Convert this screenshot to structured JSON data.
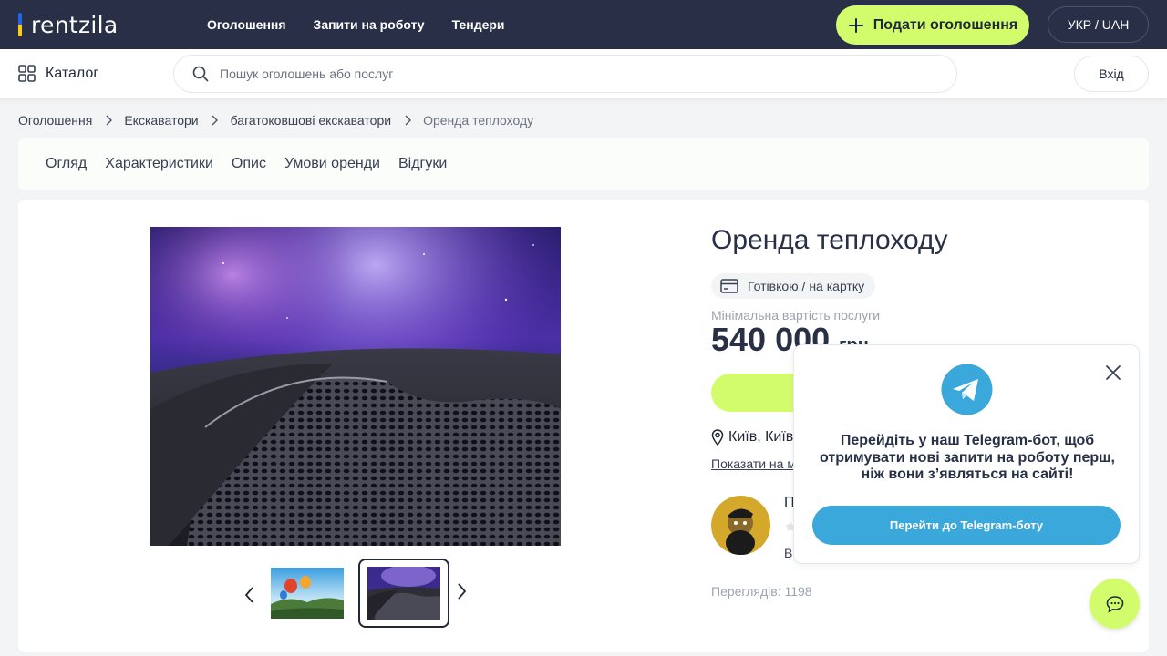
{
  "header": {
    "logo": "rentzila",
    "nav": [
      "Оголошення",
      "Запити на роботу",
      "Тендери"
    ],
    "post_button": "Подати оголошення",
    "lang_currency": "УКР / UAH"
  },
  "subheader": {
    "catalog_label": "Каталог",
    "search_placeholder": "Пошук оголошень або послуг",
    "login_label": "Вхід"
  },
  "breadcrumbs": [
    "Оголошення",
    "Екскаватори",
    "багатоковшові екскаватори",
    "Оренда теплоходу"
  ],
  "tabs": [
    "Огляд",
    "Характеристики",
    "Опис",
    "Умови оренди",
    "Відгуки"
  ],
  "listing": {
    "title": "Оренда теплоходу",
    "payment": "Готівкою / на картку",
    "min_price_label": "Мінімальна вартість послуги",
    "price": "540 000",
    "currency": "грн",
    "location": "Київ, Київ",
    "show_on_map": "Показати на м",
    "owner_initial": "П",
    "owner_link": "Вс",
    "views": "Переглядів: 1198"
  },
  "telegram": {
    "text": "Перейдіть у наш Telegram-бот, щоб отримувати нові запити на роботу перш, ніж вони з’являться на сайті!",
    "button": "Перейти до Telegram-боту"
  },
  "colors": {
    "header_bg": "#282f46",
    "accent": "#d3fc6c",
    "telegram": "#3ba8dc"
  }
}
